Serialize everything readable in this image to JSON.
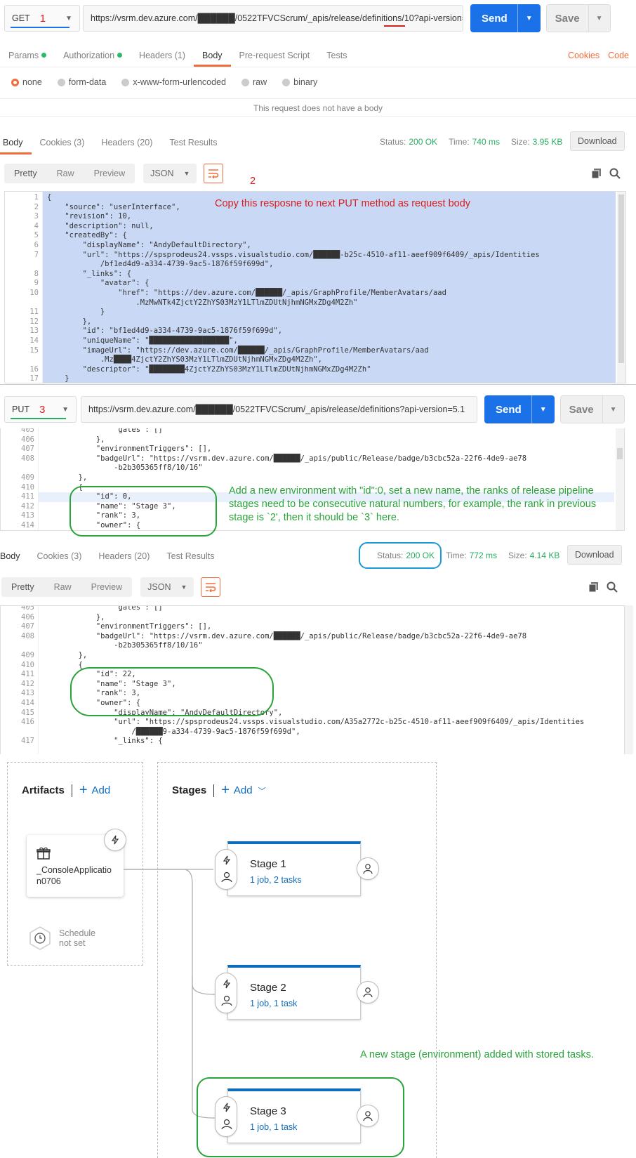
{
  "request1": {
    "method": "GET",
    "step_number": "1",
    "url": "https://vsrm.dev.azure.com/██████/0522TFVCScrum/_apis/release/definitions/10?api-version=...",
    "send_label": "Send",
    "save_label": "Save"
  },
  "request_tabs": [
    "Params",
    "Authorization",
    "Headers (1)",
    "Body",
    "Pre-request Script",
    "Tests"
  ],
  "cookies_label": "Cookies",
  "code_label": "Code",
  "body_modes": [
    "none",
    "form-data",
    "x-www-form-urlencoded",
    "raw",
    "binary"
  ],
  "no_body_text": "This request does not have a body",
  "response1": {
    "tabs": [
      "Body",
      "Cookies (3)",
      "Headers (20)",
      "Test Results"
    ],
    "status_label": "Status:",
    "status_value": "200 OK",
    "time_label": "Time:",
    "time_value": "740 ms",
    "size_label": "Size:",
    "size_value": "3.95 KB",
    "download_label": "Download",
    "view_modes": [
      "Pretty",
      "Raw",
      "Preview"
    ],
    "format": "JSON",
    "step_number": "2",
    "annotation": "Copy this resposne to next PUT method as request body",
    "lines": [
      {
        "n": "1",
        "t": "{"
      },
      {
        "n": "2",
        "t": "    \"source\": \"userInterface\","
      },
      {
        "n": "3",
        "t": "    \"revision\": 10,"
      },
      {
        "n": "4",
        "t": "    \"description\": null,"
      },
      {
        "n": "5",
        "t": "    \"createdBy\": {"
      },
      {
        "n": "6",
        "t": "        \"displayName\": \"AndyDefaultDirectory\","
      },
      {
        "n": "7",
        "t": "        \"url\": \"https://spsprodeus24.vssps.visualstudio.com/██████-b25c-4510-af11-aeef909f6409/_apis/Identities"
      },
      {
        "n": "",
        "t": "            /bf1ed4d9-a334-4739-9ac5-1876f59f699d\","
      },
      {
        "n": "8",
        "t": "        \"_links\": {"
      },
      {
        "n": "9",
        "t": "            \"avatar\": {"
      },
      {
        "n": "10",
        "t": "                \"href\": \"https://dev.azure.com/██████/_apis/GraphProfile/MemberAvatars/aad"
      },
      {
        "n": "",
        "t": "                    .MzMwNTk4ZjctY2ZhYS03MzY1LTlmZDUtNjhmNGMxZDg4M2Zh\""
      },
      {
        "n": "11",
        "t": "            }"
      },
      {
        "n": "12",
        "t": "        },"
      },
      {
        "n": "13",
        "t": "        \"id\": \"bf1ed4d9-a334-4739-9ac5-1876f59f699d\","
      },
      {
        "n": "14",
        "t": "        \"uniqueName\": \"██████████████████\","
      },
      {
        "n": "15",
        "t": "        \"imageUrl\": \"https://dev.azure.com/██████/_apis/GraphProfile/MemberAvatars/aad"
      },
      {
        "n": "",
        "t": "            .Mz████4ZjctY2ZhYS03MzY1LTlmZDUtNjhmNGMxZDg4M2Zh\","
      },
      {
        "n": "16",
        "t": "        \"descriptor\": \"████████4ZjctY2ZhYS03MzY1LTlmZDUtNjhmNGMxZDg4M2Zh\""
      },
      {
        "n": "17",
        "t": "    }"
      }
    ]
  },
  "request2": {
    "method": "PUT",
    "step_number": "3",
    "url": "https://vsrm.dev.azure.com/██████/0522TFVCScrum/_apis/release/definitions?api-version=5.1",
    "send_label": "Send",
    "save_label": "Save",
    "annotation": "Add a new environment with \"id\":0,  set a new name, the ranks of release pipeline stages need to be consecutive natural numbers, for example, the rank in previous stage is `2', then it should be `3` here.",
    "lines": [
      {
        "n": "405",
        "t": "                \"gates\": []"
      },
      {
        "n": "406",
        "t": "            },"
      },
      {
        "n": "407",
        "t": "            \"environmentTriggers\": [],"
      },
      {
        "n": "408",
        "t": "            \"badgeUrl\": \"https://vsrm.dev.azure.com/██████/_apis/public/Release/badge/b3cbc52a-22f6-4de9-ae78"
      },
      {
        "n": "",
        "t": "                -b2b305365ff8/10/16\""
      },
      {
        "n": "409",
        "t": "        },"
      },
      {
        "n": "410",
        "t": "        {"
      },
      {
        "n": "411",
        "t": "            \"id\": 0,"
      },
      {
        "n": "412",
        "t": "            \"name\": \"Stage 3\","
      },
      {
        "n": "413",
        "t": "            \"rank\": 3,"
      },
      {
        "n": "414",
        "t": "            \"owner\": {"
      }
    ]
  },
  "response2": {
    "tabs": [
      "Body",
      "Cookies (3)",
      "Headers (20)",
      "Test Results"
    ],
    "status_label": "Status:",
    "status_value": "200 OK",
    "time_label": "Time:",
    "time_value": "772 ms",
    "size_label": "Size:",
    "size_value": "4.14 KB",
    "download_label": "Download",
    "view_modes": [
      "Pretty",
      "Raw",
      "Preview"
    ],
    "format": "JSON",
    "lines": [
      {
        "n": "405",
        "t": "                \"gates\": []"
      },
      {
        "n": "406",
        "t": "            },"
      },
      {
        "n": "407",
        "t": "            \"environmentTriggers\": [],"
      },
      {
        "n": "408",
        "t": "            \"badgeUrl\": \"https://vsrm.dev.azure.com/██████/_apis/public/Release/badge/b3cbc52a-22f6-4de9-ae78"
      },
      {
        "n": "",
        "t": "                -b2b305365ff8/10/16\""
      },
      {
        "n": "409",
        "t": "        },"
      },
      {
        "n": "410",
        "t": "        {"
      },
      {
        "n": "411",
        "t": "            \"id\": 22,"
      },
      {
        "n": "412",
        "t": "            \"name\": \"Stage 3\","
      },
      {
        "n": "413",
        "t": "            \"rank\": 3,"
      },
      {
        "n": "414",
        "t": "            \"owner\": {"
      },
      {
        "n": "415",
        "t": "                \"displayName\": \"AndyDefaultDirectory\","
      },
      {
        "n": "416",
        "t": "                \"url\": \"https://spsprodeus24.vssps.visualstudio.com/A35a2772c-b25c-4510-af11-aeef909f6409/_apis/Identities"
      },
      {
        "n": "",
        "t": "                    /██████9-a334-4739-9ac5-1876f59f699d\","
      },
      {
        "n": "417",
        "t": "                \"_links\": {"
      }
    ]
  },
  "pipeline": {
    "artifacts_title": "Artifacts",
    "stages_title": "Stages",
    "add_label": "Add",
    "artifact_name": "_ConsoleApplication0706",
    "schedule_label": "Schedule not set",
    "annotation": "A new stage (environment) added with stored tasks.",
    "stages": [
      {
        "name": "Stage 1",
        "summary": "1 job, 2 tasks"
      },
      {
        "name": "Stage 2",
        "summary": "1 job, 1 task"
      },
      {
        "name": "Stage 3",
        "summary": "1 job, 1 task"
      }
    ]
  },
  "colors": {
    "accent": "#f26b3a",
    "send": "#1b72e8",
    "status_ok": "#27ae60",
    "azure_blue": "#0f6cbd",
    "annotation_green": "#2aa33a",
    "annotation_red": "#d42020"
  }
}
